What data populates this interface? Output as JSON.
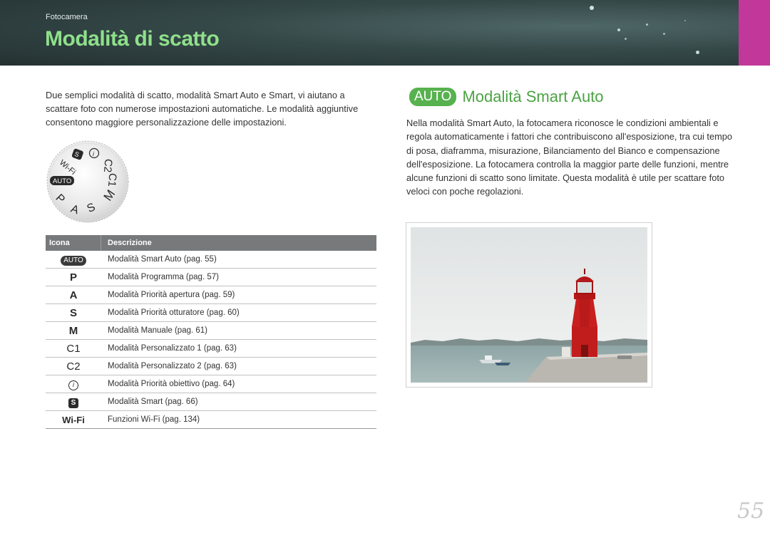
{
  "header": {
    "section": "Fotocamera",
    "title": "Modalità di scatto"
  },
  "intro": "Due semplici modalità di scatto, modalità Smart Auto e Smart, vi aiutano a scattare foto con numerose impostazioni automatiche. Le modalità aggiuntive consentono maggiore personalizzazione delle impostazioni.",
  "dial": {
    "labels": [
      "Wi-Fi",
      "S",
      "i",
      "C2",
      "C1",
      "M",
      "S",
      "A",
      "P",
      "AUTO"
    ]
  },
  "table": {
    "col_icon": "Icona",
    "col_desc": "Descrizione",
    "rows": [
      {
        "icon": "AUTO",
        "desc": "Modalità Smart Auto (pag. 55)"
      },
      {
        "icon": "P",
        "desc": "Modalità Programma (pag. 57)"
      },
      {
        "icon": "A",
        "desc": "Modalità Priorità apertura (pag. 59)"
      },
      {
        "icon": "S",
        "desc": "Modalità Priorità otturatore (pag. 60)"
      },
      {
        "icon": "M",
        "desc": "Modalità Manuale (pag. 61)"
      },
      {
        "icon": "C1",
        "desc": "Modalità Personalizzato 1 (pag. 63)"
      },
      {
        "icon": "C2",
        "desc": "Modalità Personalizzato 2 (pag. 63)"
      },
      {
        "icon": "i",
        "desc": "Modalità Priorità obiettivo (pag. 64)"
      },
      {
        "icon": "S",
        "desc": "Modalità Smart (pag. 66)"
      },
      {
        "icon": "Wi-Fi",
        "desc": "Funzioni Wi-Fi (pag. 134)"
      }
    ]
  },
  "section": {
    "badge": "AUTO",
    "title": "Modalità Smart Auto",
    "body": "Nella modalità Smart Auto, la fotocamera riconosce le condizioni ambientali e regola automaticamente i fattori che contribuiscono all'esposizione, tra cui tempo di posa, diaframma, misurazione, Bilanciamento del Bianco e compensazione dell'esposizione. La fotocamera controlla la maggior parte delle funzioni, mentre alcune funzioni di scatto sono limitate. Questa modalità è utile per scattare foto veloci con poche regolazioni."
  },
  "page_number": "55",
  "colors": {
    "title_green": "#8fe08a",
    "accent_green": "#4ba344",
    "header_dark": "#2e3e3e",
    "tab_pink": "#c2389a",
    "table_header": "#77797b"
  }
}
